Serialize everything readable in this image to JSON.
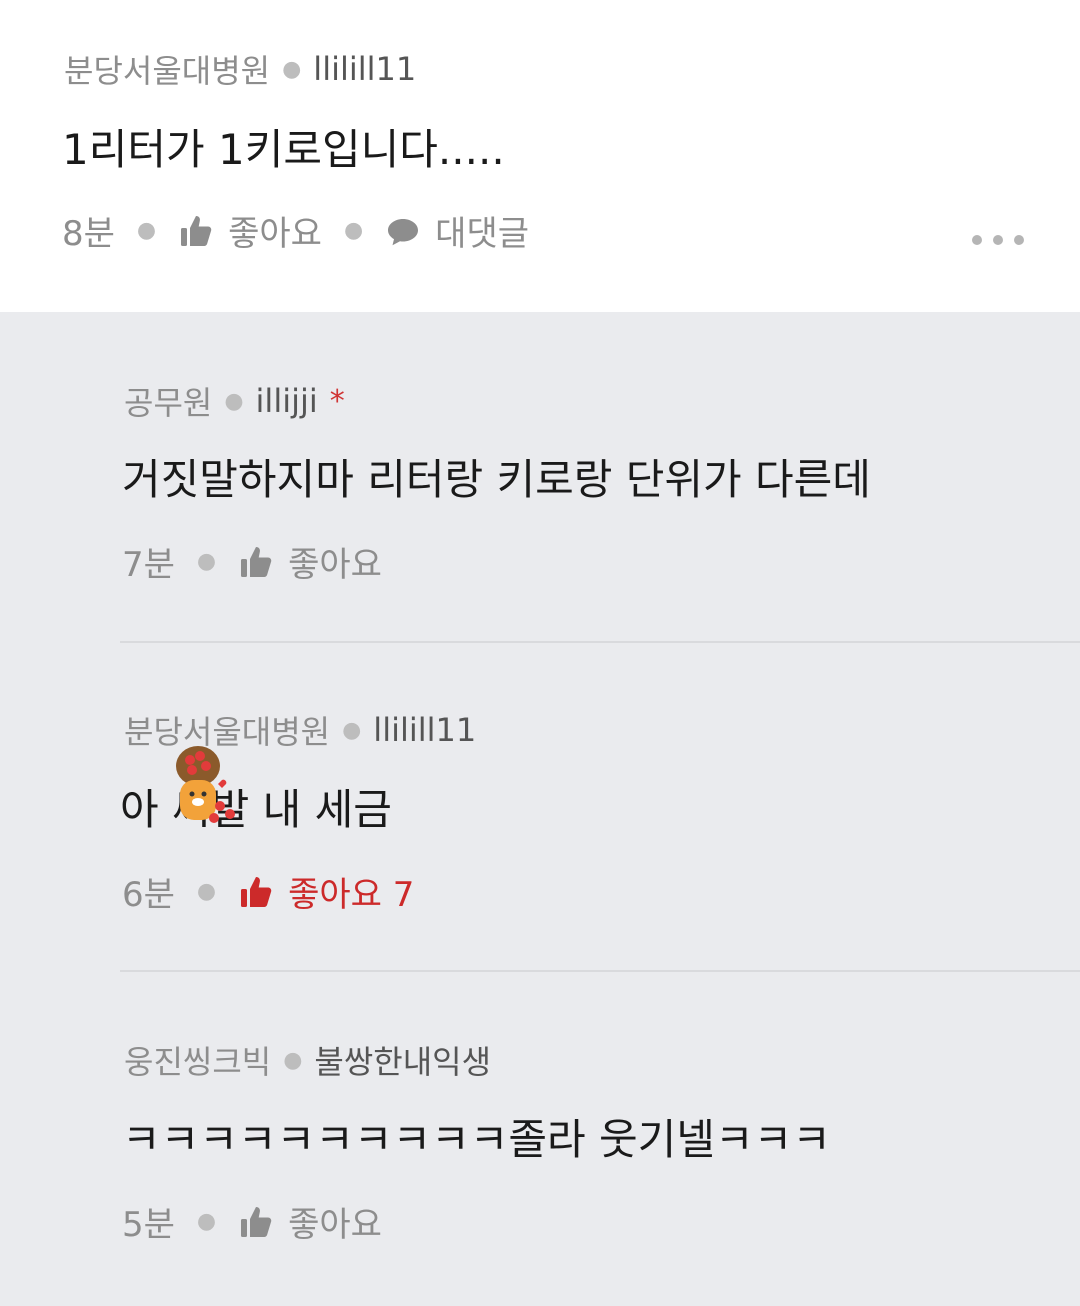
{
  "main_comment": {
    "author": "분당서울대병원",
    "user_id": "llilill11",
    "text": "1리터가 1키로입니다.....",
    "time": "8분",
    "like_label": "좋아요",
    "reply_label": "대댓글"
  },
  "replies": [
    {
      "author": "공무원",
      "user_id": "illijji",
      "badge": "*",
      "text": "거짓말하지마 리터랑 키로랑 단위가 다른데",
      "time": "7분",
      "like_label": "좋아요"
    },
    {
      "author": "분당서울대병원",
      "user_id": "llilill11",
      "text": "아 씨발 내 세금",
      "time": "6분",
      "like_label": "좋아요 7",
      "liked": true
    },
    {
      "author": "웅진씽크빅",
      "user_id": "불쌍한내익생",
      "text": "ㅋㅋㅋㅋㅋㅋㅋㅋㅋㅋ졸라 웃기넬ㅋㅋㅋ",
      "time": "5분",
      "like_label": "좋아요"
    }
  ],
  "colors": {
    "accent_like": "#cc2a2a",
    "reply_background": "#eaebee",
    "meta_text": "#8d8d8d"
  },
  "icons": {
    "like": "thumbs-up-icon",
    "reply": "speech-bubble-icon",
    "more": "more-dots-icon",
    "sticker": "heart-sticker-icon"
  }
}
